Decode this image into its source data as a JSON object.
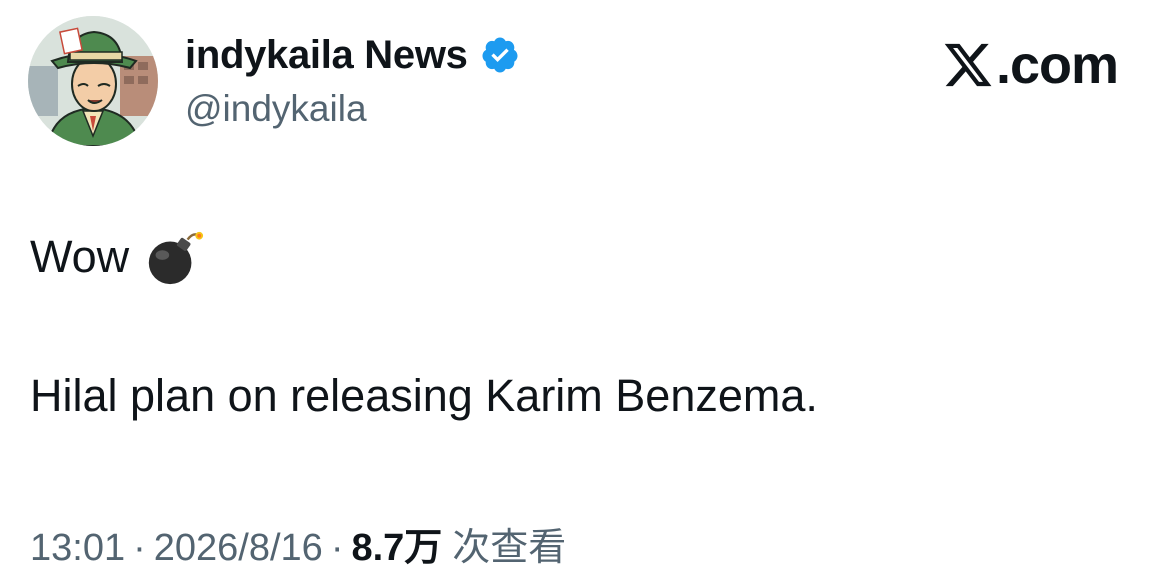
{
  "author": {
    "display_name": "indykaila News",
    "handle": "@indykaila",
    "verified": true,
    "verified_color": "#1d9bf0"
  },
  "brand": {
    "label": ".com",
    "icon": "x-logo-icon"
  },
  "tweet": {
    "line1_text": "Wow",
    "line1_emoji": "bomb-icon",
    "line2_text": "Hilal plan on releasing Karim Benzema."
  },
  "meta": {
    "time": "13:01",
    "separator": "·",
    "date": "2026/8/16",
    "views_count": "8.7万",
    "views_label": "次查看"
  },
  "colors": {
    "text_primary": "#0f1419",
    "text_secondary": "#536471",
    "accent": "#1d9bf0"
  }
}
